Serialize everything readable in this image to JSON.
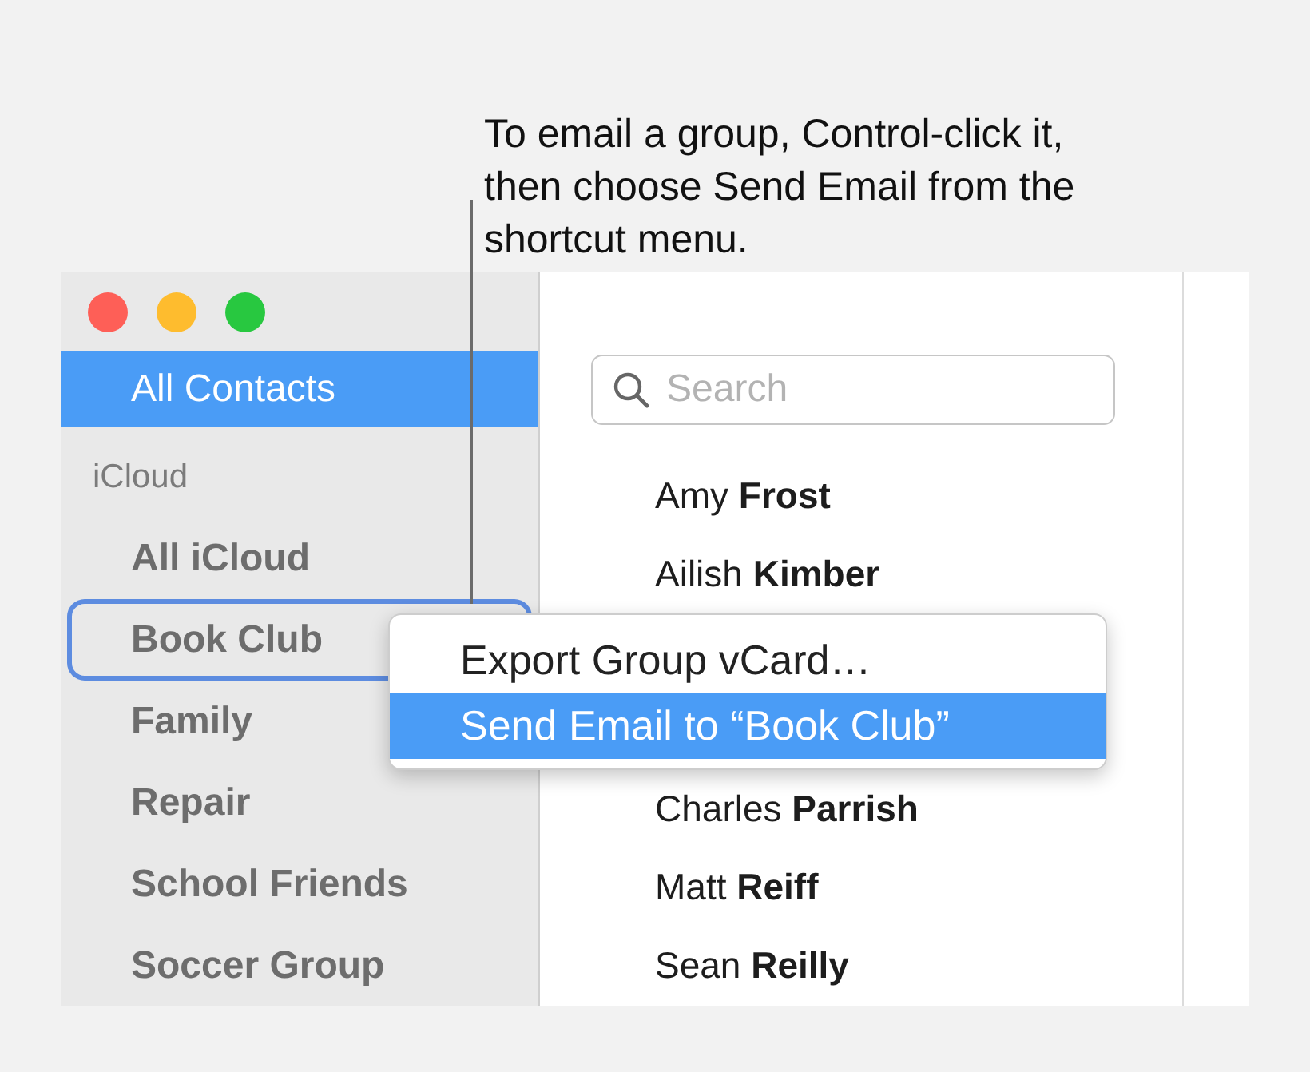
{
  "callout": {
    "text": "To email a group, Control-click it, then choose Send Email from the shortcut menu."
  },
  "window": {
    "buttons": [
      {
        "kind": "close"
      },
      {
        "kind": "minimize"
      },
      {
        "kind": "zoom"
      }
    ]
  },
  "sidebar": {
    "items": [
      {
        "kind": "item",
        "label": "All Contacts",
        "selected": true,
        "focused": false
      },
      {
        "kind": "header",
        "label": "iCloud"
      },
      {
        "kind": "item",
        "label": "All iCloud",
        "selected": false,
        "focused": false
      },
      {
        "kind": "item",
        "label": "Book Club",
        "selected": false,
        "focused": true
      },
      {
        "kind": "item",
        "label": "Family",
        "selected": false,
        "focused": false
      },
      {
        "kind": "item",
        "label": "Repair",
        "selected": false,
        "focused": false
      },
      {
        "kind": "item",
        "label": "School Friends",
        "selected": false,
        "focused": false
      },
      {
        "kind": "item",
        "label": "Soccer Group",
        "selected": false,
        "focused": false
      }
    ]
  },
  "search": {
    "placeholder": "Search"
  },
  "contacts": [
    {
      "first": "Amy",
      "last": "Frost"
    },
    {
      "first": "Ailish",
      "last": "Kimber"
    },
    {
      "first": "Charles",
      "last": "Parrish"
    },
    {
      "first": "Matt",
      "last": "Reiff"
    },
    {
      "first": "Sean",
      "last": "Reilly"
    }
  ],
  "context_menu": {
    "items": [
      {
        "label": "Export Group vCard…",
        "selected": false
      },
      {
        "label": "Send Email to “Book Club”",
        "selected": true
      }
    ]
  }
}
